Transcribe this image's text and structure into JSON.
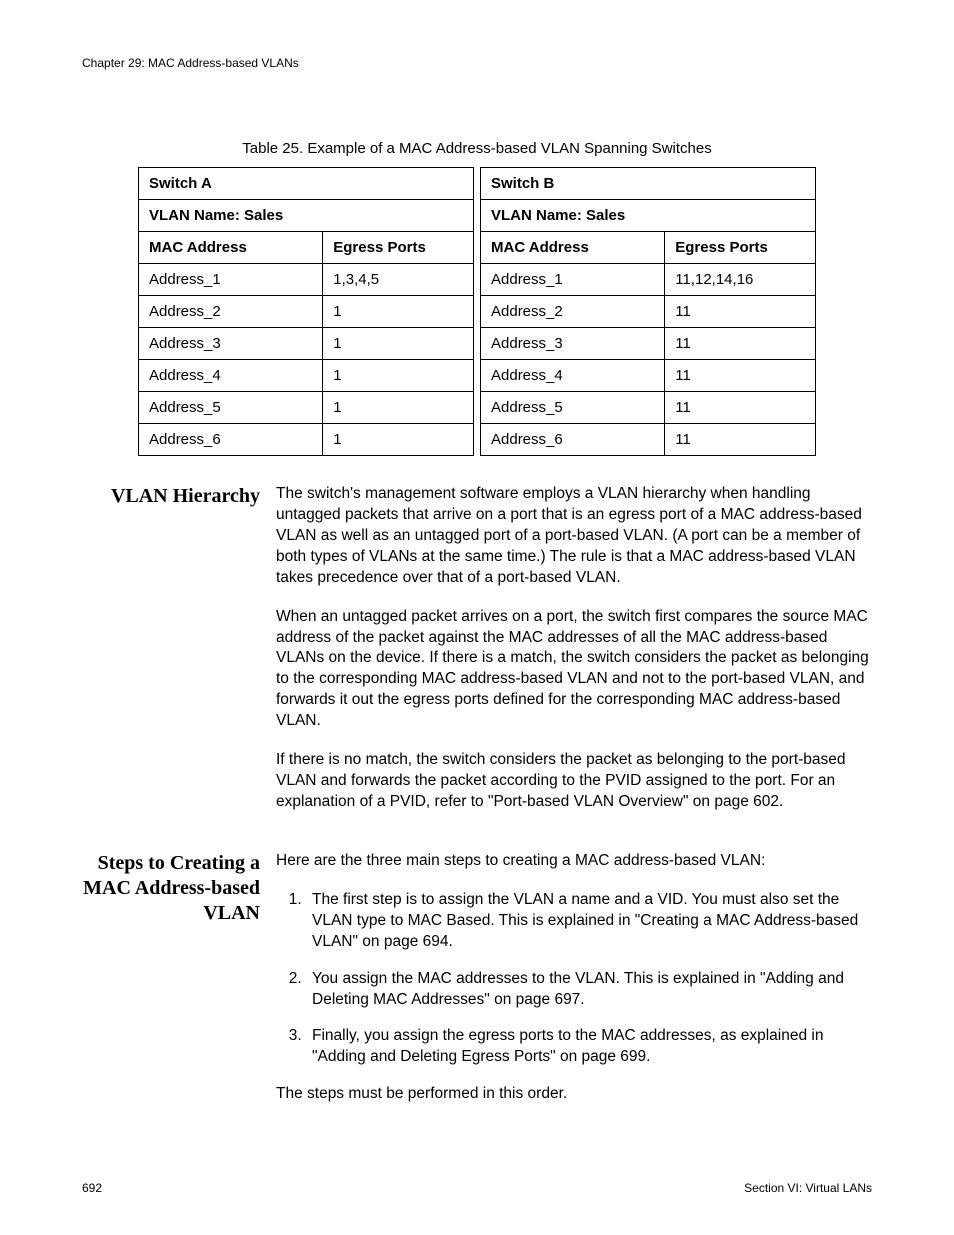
{
  "header": {
    "chapter": "Chapter 29: MAC Address-based VLANs"
  },
  "table": {
    "caption": "Table 25. Example of a MAC Address-based VLAN Spanning Switches",
    "switchA": {
      "title": "Switch A",
      "vlan": "VLAN Name: Sales",
      "col1": "MAC Address",
      "col2": "Egress Ports",
      "rows": [
        {
          "mac": "Address_1",
          "ports": "1,3,4,5"
        },
        {
          "mac": "Address_2",
          "ports": "1"
        },
        {
          "mac": "Address_3",
          "ports": "1"
        },
        {
          "mac": "Address_4",
          "ports": "1"
        },
        {
          "mac": "Address_5",
          "ports": "1"
        },
        {
          "mac": "Address_6",
          "ports": "1"
        }
      ]
    },
    "switchB": {
      "title": "Switch B",
      "vlan": "VLAN Name: Sales",
      "col1": "MAC Address",
      "col2": "Egress Ports",
      "rows": [
        {
          "mac": "Address_1",
          "ports": "11,12,14,16"
        },
        {
          "mac": "Address_2",
          "ports": "11"
        },
        {
          "mac": "Address_3",
          "ports": "11"
        },
        {
          "mac": "Address_4",
          "ports": "11"
        },
        {
          "mac": "Address_5",
          "ports": "11"
        },
        {
          "mac": "Address_6",
          "ports": "11"
        }
      ]
    }
  },
  "section1": {
    "heading": "VLAN Hierarchy",
    "p1": "The switch's management software employs a VLAN hierarchy when handling untagged packets that arrive on a port that is an egress port of a MAC address-based VLAN as well as an untagged port of a port-based VLAN. (A port can be a member of both types of VLANs at the same time.) The rule is that a MAC address-based VLAN takes precedence over that of a port-based VLAN.",
    "p2": "When an untagged packet arrives on a port, the switch first compares the source MAC address of the packet against the MAC addresses of all the MAC address-based VLANs on the device. If there is a match, the switch considers the packet as belonging to the corresponding MAC address-based VLAN and not to the port-based VLAN, and forwards it out the egress ports defined for the corresponding MAC address-based VLAN.",
    "p3": "If there is no match, the switch considers the packet as belonging to the port-based VLAN and forwards the packet according to the PVID assigned to the port. For an explanation of a PVID, refer to \"Port-based VLAN Overview\" on page 602."
  },
  "section2": {
    "heading": "Steps to Creating a MAC Address-based VLAN",
    "intro": "Here are the three main steps to creating a MAC address-based VLAN:",
    "steps": [
      "The first step is to assign the VLAN a name and a VID. You must also set the VLAN type to MAC Based. This is explained in \"Creating a MAC Address-based VLAN\" on page 694.",
      "You assign the MAC addresses to the VLAN. This is explained in \"Adding and Deleting MAC Addresses\" on page 697.",
      "Finally, you assign the egress ports to the MAC addresses, as explained in \"Adding and Deleting Egress Ports\" on page 699."
    ],
    "closing": "The steps must be performed in this order."
  },
  "footer": {
    "page": "692",
    "section": "Section VI: Virtual LANs"
  }
}
